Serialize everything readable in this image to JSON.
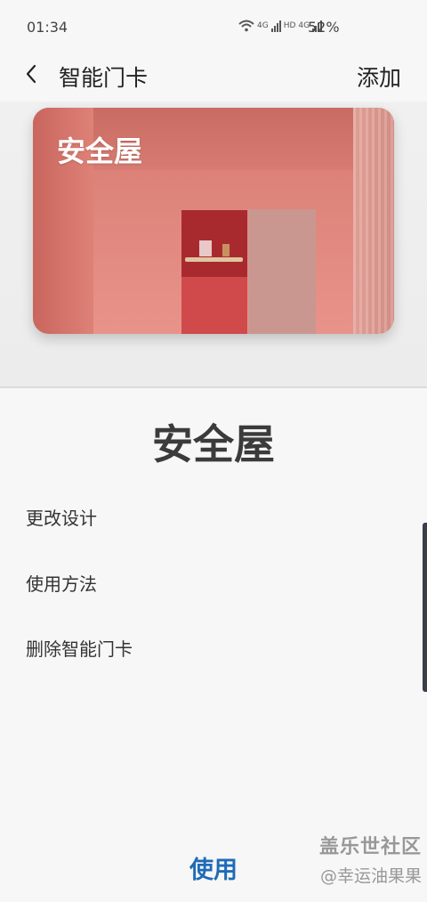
{
  "status_bar": {
    "time": "01:34",
    "battery": "52%",
    "network_1": "4G",
    "network_hd": "HD",
    "network_2": "4G"
  },
  "header": {
    "back_icon": "chevron-left-icon",
    "title": "智能门卡",
    "add_label": "添加"
  },
  "card": {
    "title": "安全屋"
  },
  "info": {
    "name": "安全屋"
  },
  "menu": [
    {
      "label": "更改设计"
    },
    {
      "label": "使用方法"
    },
    {
      "label": "删除智能门卡"
    }
  ],
  "use_button": {
    "label": "使用",
    "color": "#1e6bb8"
  },
  "watermark": {
    "line1": "盖乐世社区",
    "line2": "@幸运油果果"
  }
}
